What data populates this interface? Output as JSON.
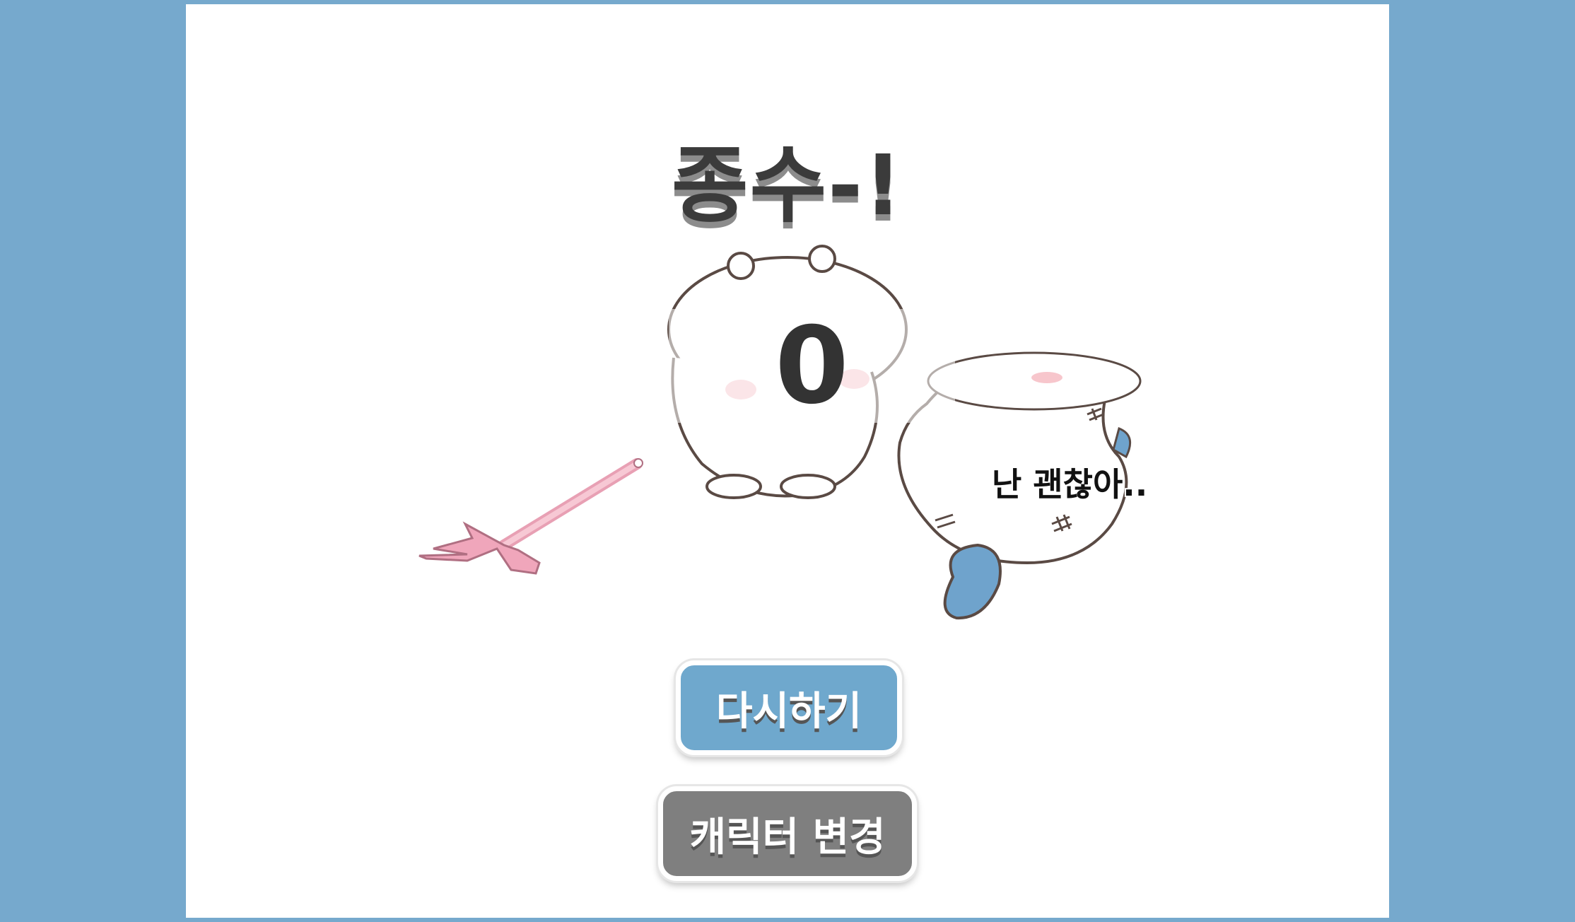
{
  "result": {
    "title": "종수-!"
  },
  "score": {
    "value": "0"
  },
  "character": {
    "speech": "난 괜찮아.."
  },
  "buttons": {
    "retry_label": "다시하기",
    "change_character_label": "캐릭터 변경"
  },
  "colors": {
    "page_background": "#76a9cd",
    "stage_background": "#ffffff",
    "retry_button": "#6fa8cd",
    "change_character_button": "#7f7f7f",
    "title_text": "#3b3b3b"
  }
}
